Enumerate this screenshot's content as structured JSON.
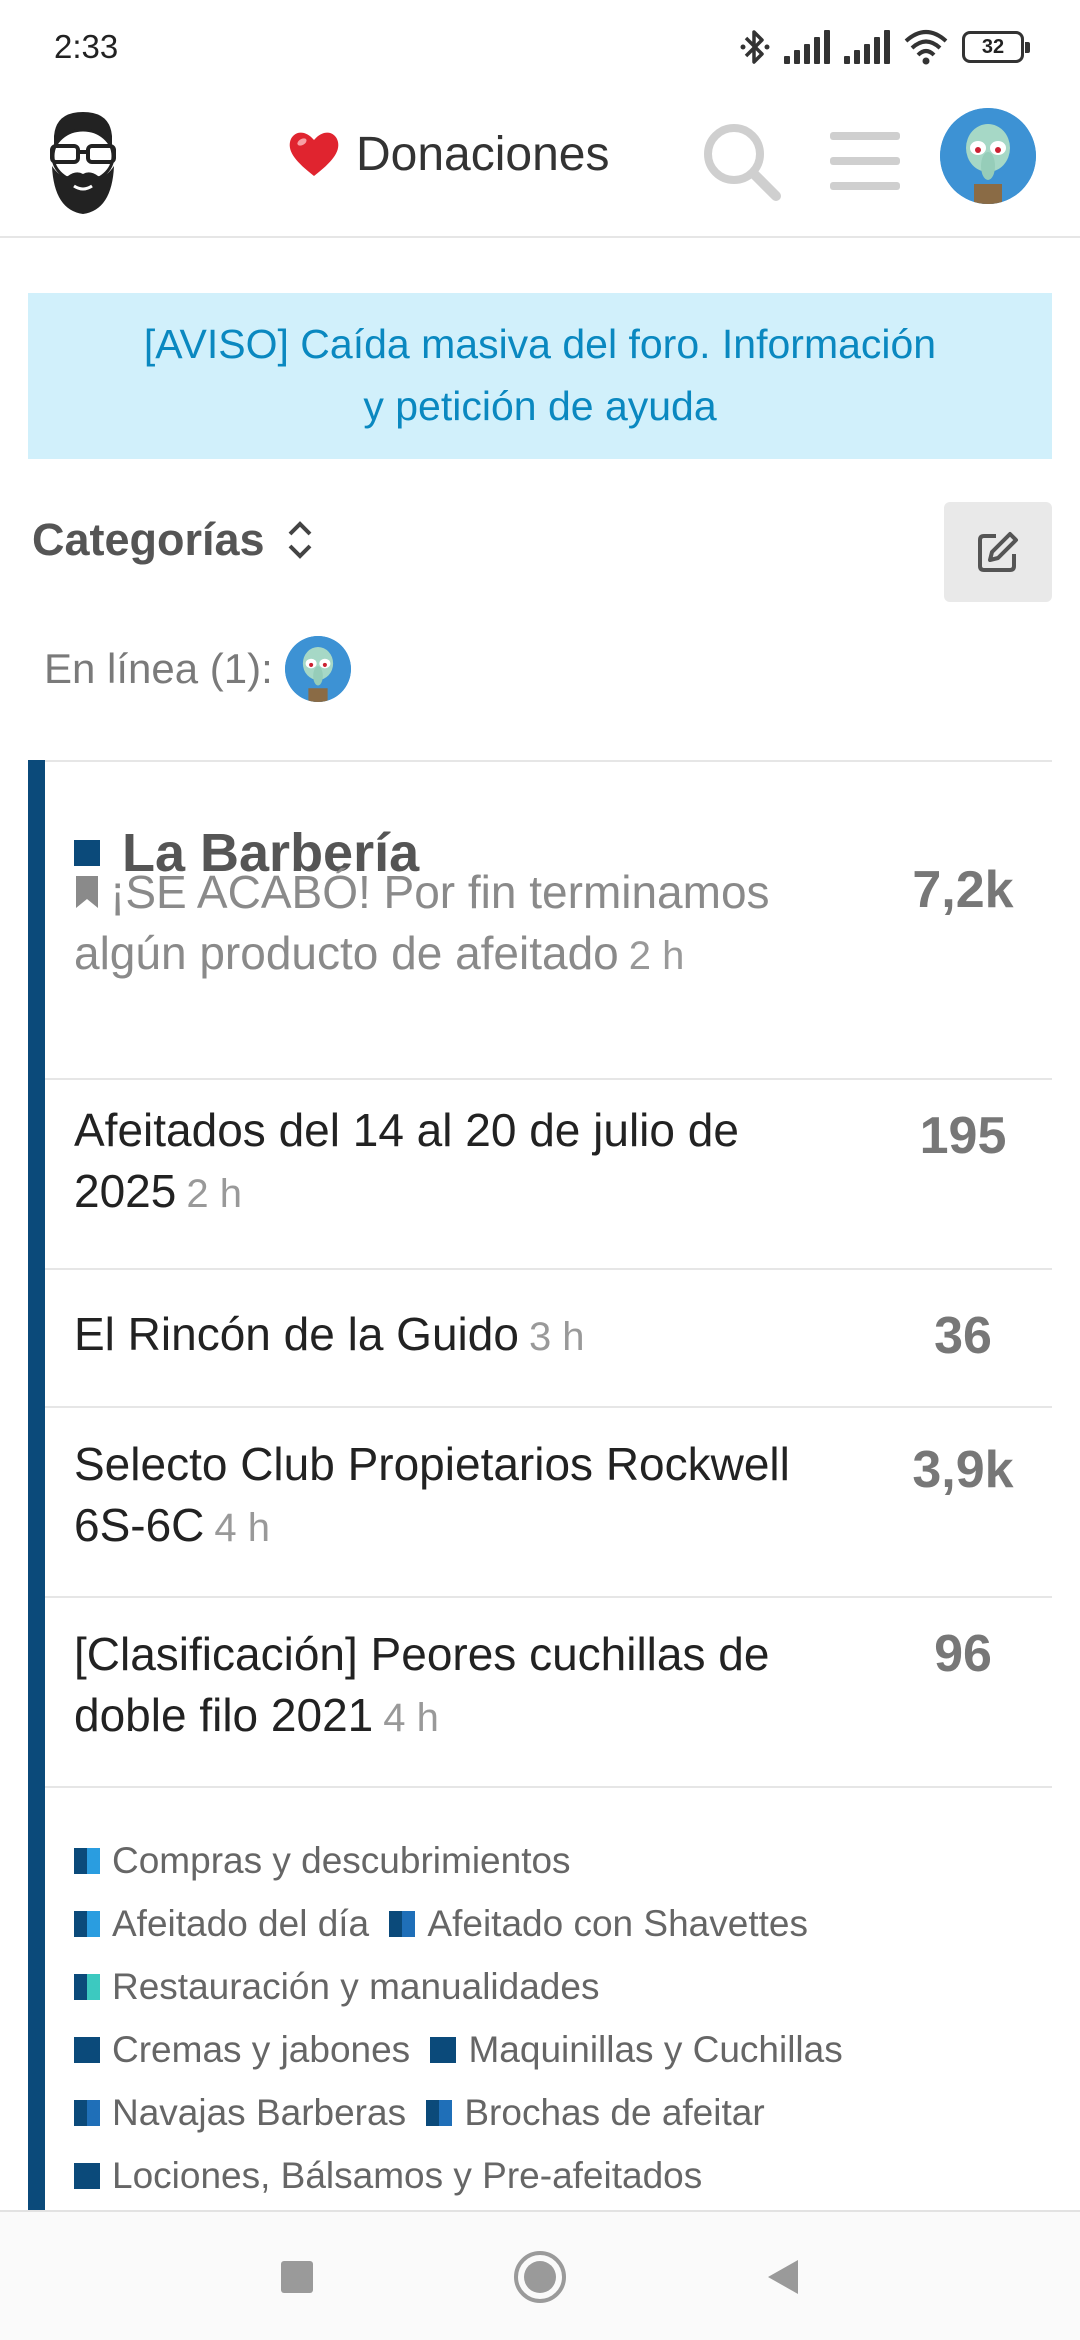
{
  "status_bar": {
    "time": "2:33",
    "battery": "32",
    "icons": [
      "bluetooth-icon",
      "signal-icon",
      "signal-icon",
      "wifi-icon",
      "battery-icon"
    ]
  },
  "header": {
    "logo_icon": "bearded-man-logo",
    "donate_label": "Donaciones",
    "heart_icon": "heart-icon",
    "search_icon": "search-icon",
    "menu_icon": "hamburger-menu-icon",
    "avatar_icon": "user-avatar"
  },
  "notice": {
    "line1": "[AVISO] Caída masiva del foro. Información",
    "line2": "y petición de ayuda"
  },
  "categories_header": {
    "title": "Categorías",
    "sort_icon": "chevron-up-down-icon",
    "edit_icon": "edit-icon"
  },
  "online": {
    "label": "En línea (1):"
  },
  "category": {
    "name": "La Barbería",
    "color": "#0b4a7a",
    "topics": [
      {
        "title_line1": "¡SE ACABÓ! Por fin terminamos",
        "title_line2": "algún producto de afeitado",
        "time": "2 h",
        "count": "7,2k",
        "pinned": true
      },
      {
        "title_line1": "Afeitados del 14 al 20 de julio de",
        "title_line2": "2025",
        "time": "2 h",
        "count": "195"
      },
      {
        "title_line1": "El Rincón de la Guido",
        "title_line2": "",
        "time": "3 h",
        "count": "36"
      },
      {
        "title_line1": "Selecto Club Propietarios Rockwell",
        "title_line2": "6S-6C",
        "time": "4 h",
        "count": "3,9k"
      },
      {
        "title_line1": "[Clasificación] Peores cuchillas de",
        "title_line2": "doble filo 2021",
        "time": "4 h",
        "count": "96"
      }
    ],
    "subcategories": [
      "Compras y descubrimientos",
      "Afeitado del día",
      "Afeitado con Shavettes",
      "Restauración y manualidades",
      "Cremas y jabones",
      "Maquinillas y Cuchillas",
      "Navajas Barberas",
      "Brochas de afeitar",
      "Lociones, Bálsamos y Pre-afeitados"
    ]
  },
  "navbar": {
    "icons": [
      "recent-apps-icon",
      "home-icon",
      "back-icon"
    ]
  }
}
